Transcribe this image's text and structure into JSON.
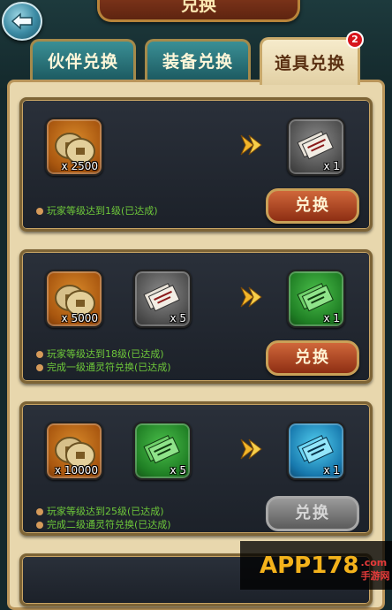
{
  "header": {
    "title": "兑换"
  },
  "tabs": [
    {
      "label": "伙伴兑换",
      "active": false
    },
    {
      "label": "装备兑换",
      "active": false
    },
    {
      "label": "道具兑换",
      "active": true
    }
  ],
  "tab_badge": "2",
  "cards": [
    {
      "inputs": [
        {
          "icon": "coin-icon",
          "qty": "x 2500"
        }
      ],
      "output": {
        "icon": "gray-talisman-icon",
        "qty": "x 1"
      },
      "requirements": [
        "玩家等级达到1级(已达成)"
      ],
      "button": "兑换",
      "button_enabled": true
    },
    {
      "inputs": [
        {
          "icon": "coin-icon",
          "qty": "x 5000"
        },
        {
          "icon": "gray-talisman-icon",
          "qty": "x 5"
        }
      ],
      "output": {
        "icon": "green-talisman-icon",
        "qty": "x 1"
      },
      "requirements": [
        "玩家等级达到18级(已达成)",
        "完成一级通灵符兑换(已达成)"
      ],
      "button": "兑换",
      "button_enabled": true
    },
    {
      "inputs": [
        {
          "icon": "coin-icon",
          "qty": "x 10000"
        },
        {
          "icon": "green-talisman-icon",
          "qty": "x 5"
        }
      ],
      "output": {
        "icon": "blue-talisman-icon",
        "qty": "x 1"
      },
      "requirements": [
        "玩家等级达到25级(已达成)",
        "完成二级通灵符兑换(已达成)"
      ],
      "button": "兑换",
      "button_enabled": false
    }
  ],
  "watermark": {
    "text": "APP178",
    "sub": ".com手游网"
  },
  "colors": {
    "requirement_text": "#6ec83a",
    "panel": "#e8d7ad",
    "card": "#22272f"
  }
}
